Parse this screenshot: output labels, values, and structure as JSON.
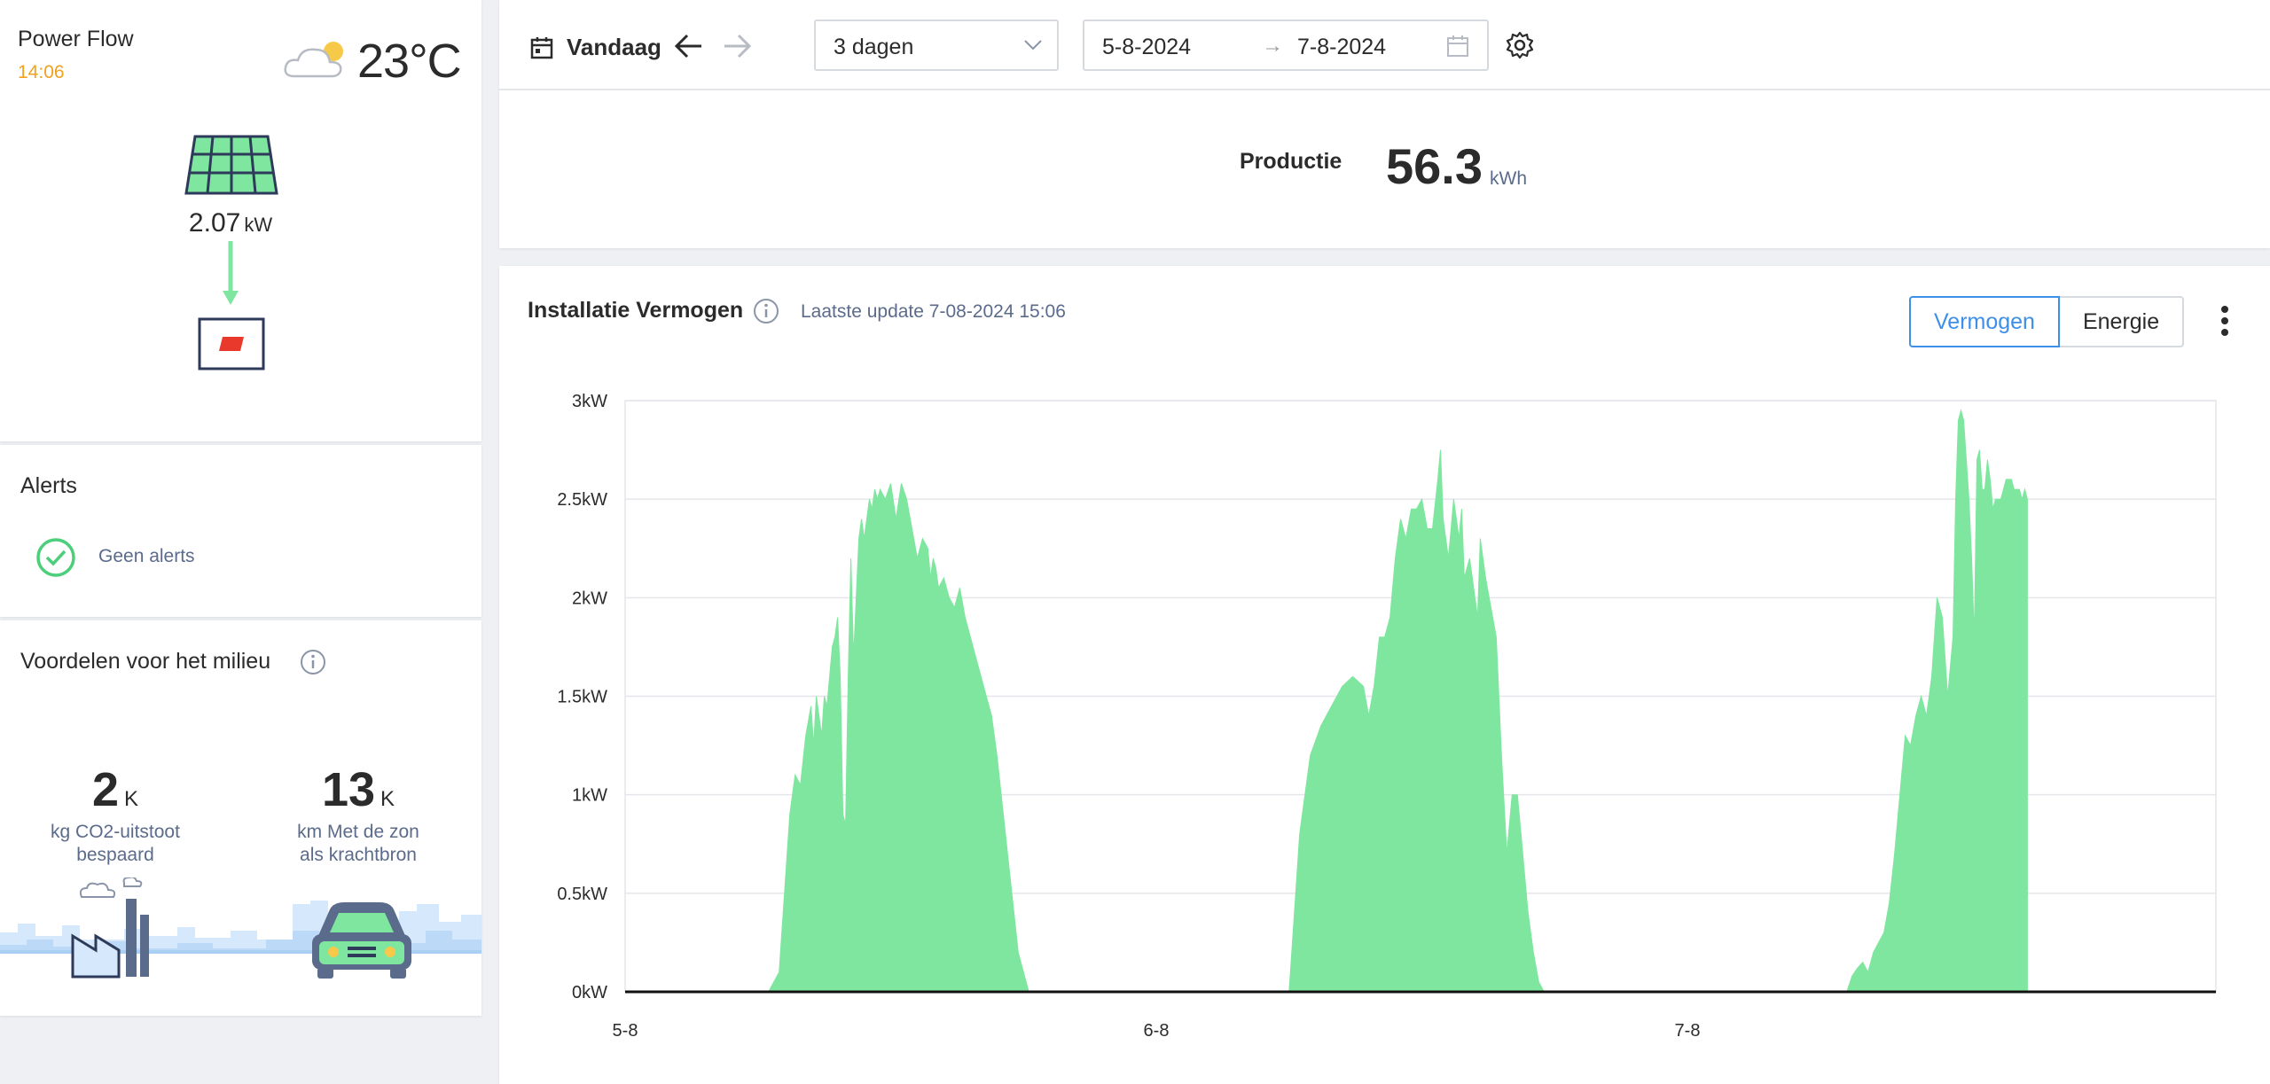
{
  "power_flow": {
    "title": "Power Flow",
    "time": "14:06",
    "temperature": "23°C",
    "pv_power": "2.07",
    "pv_unit": "kW",
    "accent_color": "#f0a21d"
  },
  "alerts": {
    "title": "Alerts",
    "status": "Geen alerts"
  },
  "environment": {
    "title": "Voordelen voor het milieu",
    "co2_value": "2",
    "co2_suffix": "K",
    "co2_label_line1": "kg CO2-uitstoot",
    "co2_label_line2": "bespaard",
    "km_value": "13",
    "km_suffix": "K",
    "km_label_line1": "km Met de zon",
    "km_label_line2": "als krachtbron"
  },
  "toolbar": {
    "today_label": "Vandaag",
    "period_select": "3 dagen",
    "date_from": "5-8-2024",
    "date_arrow": "→",
    "date_to": "7-8-2024"
  },
  "production": {
    "label": "Productie",
    "value": "56.3",
    "unit": "kWh"
  },
  "chart_card": {
    "title": "Installatie Vermogen",
    "last_update": "Laatste update 7-08-2024 15:06",
    "btn_power": "Vermogen",
    "btn_energy": "Energie",
    "active_button": "Vermogen",
    "active_color": "#3d8fe8"
  },
  "chart_data": {
    "type": "area",
    "title": "",
    "xlabel": "",
    "ylabel": "",
    "x_ticks": [
      "5-8",
      "6-8",
      "7-8"
    ],
    "y_ticks": [
      "0kW",
      "0.5kW",
      "1kW",
      "1.5kW",
      "2kW",
      "2.5kW",
      "3kW"
    ],
    "ylim": [
      0,
      3
    ],
    "xlim_days": [
      0,
      3
    ],
    "grid": true,
    "fill_color": "#7ee69e",
    "series": [
      {
        "x": [
          0.27,
          0.29,
          0.31,
          0.32,
          0.33,
          0.34,
          0.35,
          0.355,
          0.36,
          0.37,
          0.375,
          0.38,
          0.385,
          0.39,
          0.395,
          0.4,
          0.405,
          0.41,
          0.415,
          0.42,
          0.425,
          0.43,
          0.44,
          0.445,
          0.45,
          0.455,
          0.46,
          0.465,
          0.47,
          0.475,
          0.48,
          0.49,
          0.5,
          0.51,
          0.52,
          0.53,
          0.54,
          0.55,
          0.56,
          0.57,
          0.575,
          0.58,
          0.585,
          0.59,
          0.6,
          0.61,
          0.62,
          0.63,
          0.64,
          0.65,
          0.66,
          0.67,
          0.68,
          0.69,
          0.7,
          0.72,
          0.74,
          0.76,
          0.78,
          0.8,
          0.82,
          0.84,
          0.86,
          0.88,
          0.9,
          0.91,
          0.92
        ],
        "y": [
          0.0,
          0.1,
          0.9,
          1.1,
          1.05,
          1.3,
          1.45,
          1.25,
          1.5,
          1.3,
          1.5,
          1.45,
          1.6,
          1.75,
          1.8,
          1.9,
          1.6,
          0.9,
          0.85,
          1.6,
          2.2,
          1.7,
          2.3,
          2.4,
          2.3,
          2.4,
          2.5,
          2.45,
          2.55,
          2.5,
          2.55,
          2.5,
          2.58,
          2.4,
          2.58,
          2.5,
          2.35,
          2.2,
          2.3,
          2.25,
          2.1,
          2.2,
          2.15,
          2.05,
          2.1,
          2.0,
          1.95,
          2.05,
          1.9,
          1.8,
          1.7,
          1.6,
          1.5,
          1.4,
          1.2,
          0.7,
          0.2,
          0.0,
          0.0,
          0.0,
          0.0,
          0.0,
          0.0,
          0.0,
          0.0,
          0.0,
          0.0
        ],
        "name": ""
      },
      {
        "x": [
          1.25,
          1.27,
          1.29,
          1.31,
          1.33,
          1.35,
          1.37,
          1.39,
          1.4,
          1.41,
          1.42,
          1.43,
          1.44,
          1.45,
          1.46,
          1.47,
          1.48,
          1.49,
          1.5,
          1.51,
          1.52,
          1.53,
          1.535,
          1.54,
          1.55,
          1.56,
          1.57,
          1.575,
          1.58,
          1.59,
          1.6,
          1.605,
          1.61,
          1.62,
          1.63,
          1.64,
          1.65,
          1.66,
          1.67,
          1.68,
          1.69,
          1.7,
          1.71,
          1.72,
          1.73,
          1.74,
          1.75
        ],
        "y": [
          0.0,
          0.8,
          1.2,
          1.35,
          1.45,
          1.55,
          1.6,
          1.55,
          1.4,
          1.55,
          1.8,
          1.8,
          1.9,
          2.2,
          2.4,
          2.3,
          2.45,
          2.45,
          2.5,
          2.35,
          2.35,
          2.6,
          2.75,
          2.4,
          2.2,
          2.5,
          2.3,
          2.45,
          2.1,
          2.2,
          2.0,
          1.9,
          2.3,
          2.1,
          1.95,
          1.8,
          1.2,
          0.7,
          1.0,
          1.0,
          0.7,
          0.4,
          0.2,
          0.05,
          0.0,
          0.0,
          0.0
        ],
        "name": ""
      },
      {
        "x": [
          2.3,
          2.31,
          2.32,
          2.33,
          2.34,
          2.35,
          2.36,
          2.37,
          2.38,
          2.39,
          2.4,
          2.41,
          2.42,
          2.43,
          2.44,
          2.45,
          2.46,
          2.47,
          2.48,
          2.49,
          2.5,
          2.505,
          2.51,
          2.515,
          2.52,
          2.525,
          2.53,
          2.535,
          2.54,
          2.545,
          2.55,
          2.555,
          2.56,
          2.565,
          2.57,
          2.575,
          2.58,
          2.585,
          2.59,
          2.595,
          2.6,
          2.605,
          2.61,
          2.615,
          2.62,
          2.625,
          2.63,
          2.635,
          2.64
        ],
        "y": [
          0.0,
          0.08,
          0.12,
          0.15,
          0.1,
          0.2,
          0.25,
          0.3,
          0.45,
          0.7,
          1.0,
          1.3,
          1.25,
          1.4,
          1.5,
          1.4,
          1.6,
          2.0,
          1.9,
          1.5,
          1.8,
          2.5,
          2.9,
          2.95,
          2.9,
          2.7,
          2.5,
          2.2,
          1.8,
          2.7,
          2.75,
          2.55,
          2.55,
          2.7,
          2.6,
          2.45,
          2.5,
          2.5,
          2.5,
          2.55,
          2.6,
          2.6,
          2.6,
          2.55,
          2.55,
          2.55,
          2.5,
          2.55,
          2.5
        ],
        "name": ""
      }
    ]
  }
}
